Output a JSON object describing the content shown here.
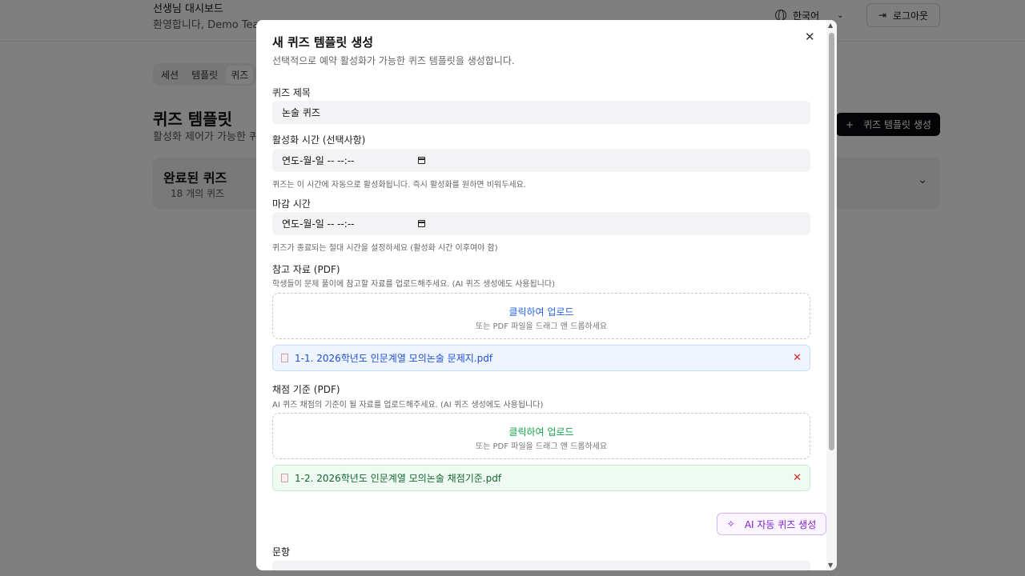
{
  "header": {
    "title": "선생님 대시보드",
    "welcome": "환영합니다, Demo Teacher",
    "language": "한국어",
    "logout": "로그아웃"
  },
  "tabs": [
    {
      "label": "세션",
      "active": false
    },
    {
      "label": "템플릿",
      "active": false
    },
    {
      "label": "퀴즈",
      "active": true
    }
  ],
  "section": {
    "title": "퀴즈 템플릿",
    "subtitle": "활성화 제어가 가능한 퀴즈 템플릿",
    "create_button": "퀴즈 템플릿 생성"
  },
  "card": {
    "title": "완료된 퀴즈",
    "count": "18 개의 퀴즈"
  },
  "modal": {
    "title": "새 퀴즈 템플릿 생성",
    "description": "선택적으로 예약 활성화가 가능한 퀴즈 템플릿을 생성합니다.",
    "quiz_title_label": "퀴즈 제목",
    "quiz_title_value": "논술 퀴즈",
    "activation_label": "활성화 시간 (선택사항)",
    "activation_value": "연도-월-일 -- --:--",
    "activation_hint": "퀴즈는 이 시간에 자동으로 활성화됩니다. 즉시 활성화를 원하면 비워두세요.",
    "deadline_label": "마감 시간",
    "deadline_value": "연도-월-일 -- --:--",
    "deadline_hint": "퀴즈가 종료되는 절대 시간을 설정하세요 (활성화 시간 이후여야 함)",
    "reference_label": "참고 자료 (PDF)",
    "reference_hint": "학생들이 문제 풀이에 참고할 자료를 업로드해주세요. (AI 퀴즈 생성에도 사용됩니다)",
    "reference_upload": "클릭하여 업로드",
    "reference_drag": "또는 PDF 파일을 드래그 앤 드롭하세요",
    "reference_file": "1-1. 2026학년도 인문계열 모의논술 문제지.pdf",
    "rubric_label": "채점 기준 (PDF)",
    "rubric_hint": "AI 퀴즈 채점의 기준이 될 자료를 업로드해주세요. (AI 퀴즈 생성에도 사용됩니다)",
    "rubric_upload": "클릭하여 업로드",
    "rubric_drag": "또는 PDF 파일을 드래그 앤 드롭하세요",
    "rubric_file": "1-2. 2026학년도 인문계열 모의논술 채점기준.pdf",
    "ai_button": "AI 자동 퀴즈 생성",
    "questions_label": "문항"
  },
  "icons": {
    "close": "close-icon",
    "remove": "x-icon",
    "sparkle": "sparkle-icon",
    "calendar": "calendar-icon"
  }
}
